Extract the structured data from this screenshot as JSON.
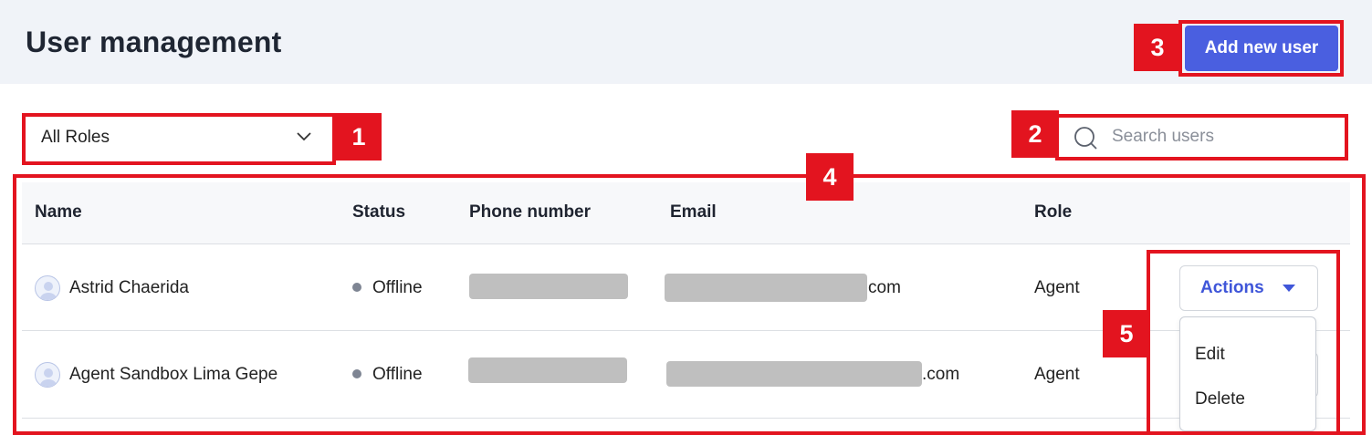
{
  "header": {
    "title": "User management",
    "add_button": "Add new user"
  },
  "filters": {
    "role_select_value": "All Roles",
    "search_placeholder": "Search users"
  },
  "table": {
    "columns": [
      "Name",
      "Status",
      "Phone number",
      "Email",
      "Role"
    ],
    "rows": [
      {
        "name": "Astrid Chaerida",
        "status": "Offline",
        "email_suffix": "com",
        "role": "Agent",
        "actions_label": "Actions"
      },
      {
        "name": "Agent Sandbox Lima Gepe",
        "status": "Offline",
        "email_suffix": ".com",
        "role": "Agent"
      }
    ]
  },
  "actions_menu": {
    "items": [
      "Edit",
      "Delete"
    ]
  },
  "annotations": [
    "1",
    "2",
    "3",
    "4",
    "5"
  ],
  "colors": {
    "accent": "#4a5fe0",
    "annotation": "#e3141f",
    "header_bg": "#f0f3f8",
    "redaction": "#bfbfbf"
  }
}
